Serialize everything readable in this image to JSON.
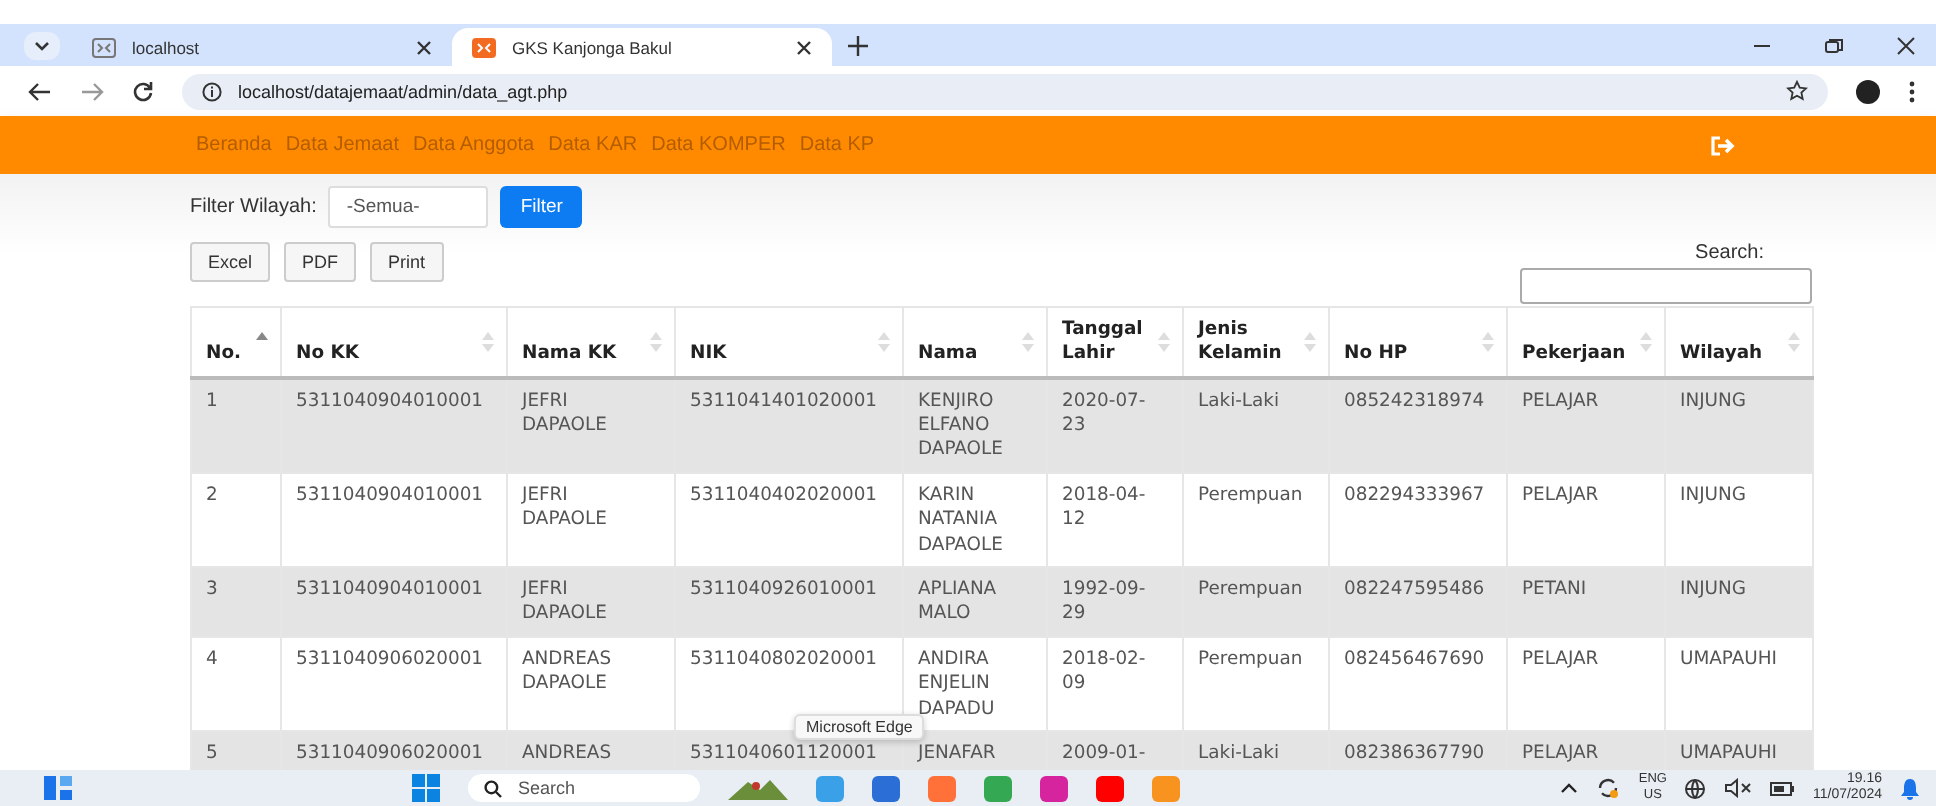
{
  "browser": {
    "tabs": [
      {
        "title": "localhost",
        "selected": false
      },
      {
        "title": "GKS Kanjonga Bakul",
        "selected": true
      }
    ],
    "address": "localhost/datajemaat/admin/data_agt.php"
  },
  "nav": {
    "items": [
      "Beranda",
      "Data Jemaat",
      "Data Anggota",
      "Data KAR",
      "Data KOMPER",
      "Data KP"
    ]
  },
  "filter": {
    "label": "Filter Wilayah:",
    "value": "-Semua-",
    "button": "Filter"
  },
  "export_buttons": [
    "Excel",
    "PDF",
    "Print"
  ],
  "search": {
    "label": "Search:"
  },
  "table": {
    "columns": [
      {
        "label": "No.",
        "sorted": true
      },
      {
        "label": "No KK",
        "sorted": false
      },
      {
        "label": "Nama KK",
        "sorted": false
      },
      {
        "label": "NIK",
        "sorted": false
      },
      {
        "label": "Nama",
        "sorted": false
      },
      {
        "label": "Tanggal Lahir",
        "sorted": false
      },
      {
        "label": "Jenis Kelamin",
        "sorted": false
      },
      {
        "label": "No HP",
        "sorted": false
      },
      {
        "label": "Pekerjaan",
        "sorted": false
      },
      {
        "label": "Wilayah",
        "sorted": false
      }
    ],
    "rows": [
      [
        "1",
        "5311040904010001",
        "JEFRI DAPAOLE",
        "5311041401020001",
        "KENJIRO ELFANO DAPAOLE",
        "2020-07-23",
        "Laki-Laki",
        "085242318974",
        "PELAJAR",
        "INJUNG"
      ],
      [
        "2",
        "5311040904010001",
        "JEFRI DAPAOLE",
        "5311040402020001",
        "KARIN NATANIA DAPAOLE",
        "2018-04-12",
        "Perempuan",
        "082294333967",
        "PELAJAR",
        "INJUNG"
      ],
      [
        "3",
        "5311040904010001",
        "JEFRI DAPAOLE",
        "5311040926010001",
        "APLIANA MALO",
        "1992-09-29",
        "Perempuan",
        "082247595486",
        "PETANI",
        "INJUNG"
      ],
      [
        "4",
        "5311040906020001",
        "ANDREAS DAPAOLE",
        "5311040802020001",
        "ANDIRA ENJELIN DAPADU",
        "2018-02-09",
        "Perempuan",
        "082456467690",
        "PELAJAR",
        "UMAPAUHI"
      ],
      [
        "5",
        "5311040906020001",
        "ANDREAS",
        "5311040601120001",
        "JENAFAR",
        "2009-01-",
        "Laki-Laki",
        "082386367790",
        "PELAJAR",
        "UMAPAUHI"
      ]
    ]
  },
  "tooltip": "Microsoft Edge",
  "taskbar": {
    "search_placeholder": "Search",
    "language": "ENG",
    "region": "US",
    "time": "19.16",
    "date": "11/07/2024"
  }
}
